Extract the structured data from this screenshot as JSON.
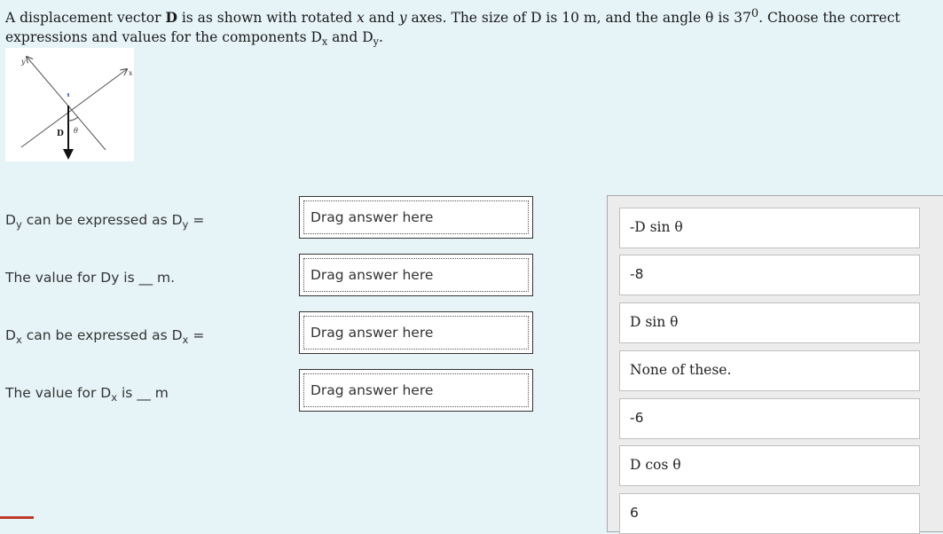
{
  "question": {
    "p1": "A displacement vector ",
    "vec": "D",
    "p2": " is as shown with rotated ",
    "xvar": "x",
    "p3": " and ",
    "yvar": "y",
    "p4": " axes. The size of D is 10 m, and the angle θ is 37",
    "degree": "0",
    "p5": ". Choose the correct expressions and values for   the components D",
    "sub_x": "x",
    "p6": " and D",
    "sub_y": "y",
    "p7": "."
  },
  "figure": {
    "y_axis_label": "y",
    "x_axis_label": "x",
    "vector_label": "D",
    "angle_label": "θ"
  },
  "prompts": [
    {
      "pre": "D",
      "sub": "y",
      "mid": " can be expressed as D",
      "sub2": "y",
      "post": " ="
    },
    {
      "pre": "The value for Dy is ",
      "blank": "__",
      "post": " m."
    },
    {
      "pre": "D",
      "sub": "x",
      "mid": " can be expressed as D",
      "sub2": "x",
      "post": "  ="
    },
    {
      "pre": "The value for D",
      "sub": "x",
      "mid": " is ",
      "blank": "__",
      "post": " m"
    }
  ],
  "dropzones": [
    {
      "placeholder": "Drag answer here"
    },
    {
      "placeholder": "Drag answer here"
    },
    {
      "placeholder": "Drag answer here"
    },
    {
      "placeholder": "Drag answer here"
    }
  ],
  "answers": [
    {
      "label": "-D sin θ"
    },
    {
      "label": "-8"
    },
    {
      "label": "D sin θ"
    },
    {
      "label": "None of these."
    },
    {
      "label": "-6"
    },
    {
      "label": "D cos θ"
    },
    {
      "label": "6"
    }
  ]
}
